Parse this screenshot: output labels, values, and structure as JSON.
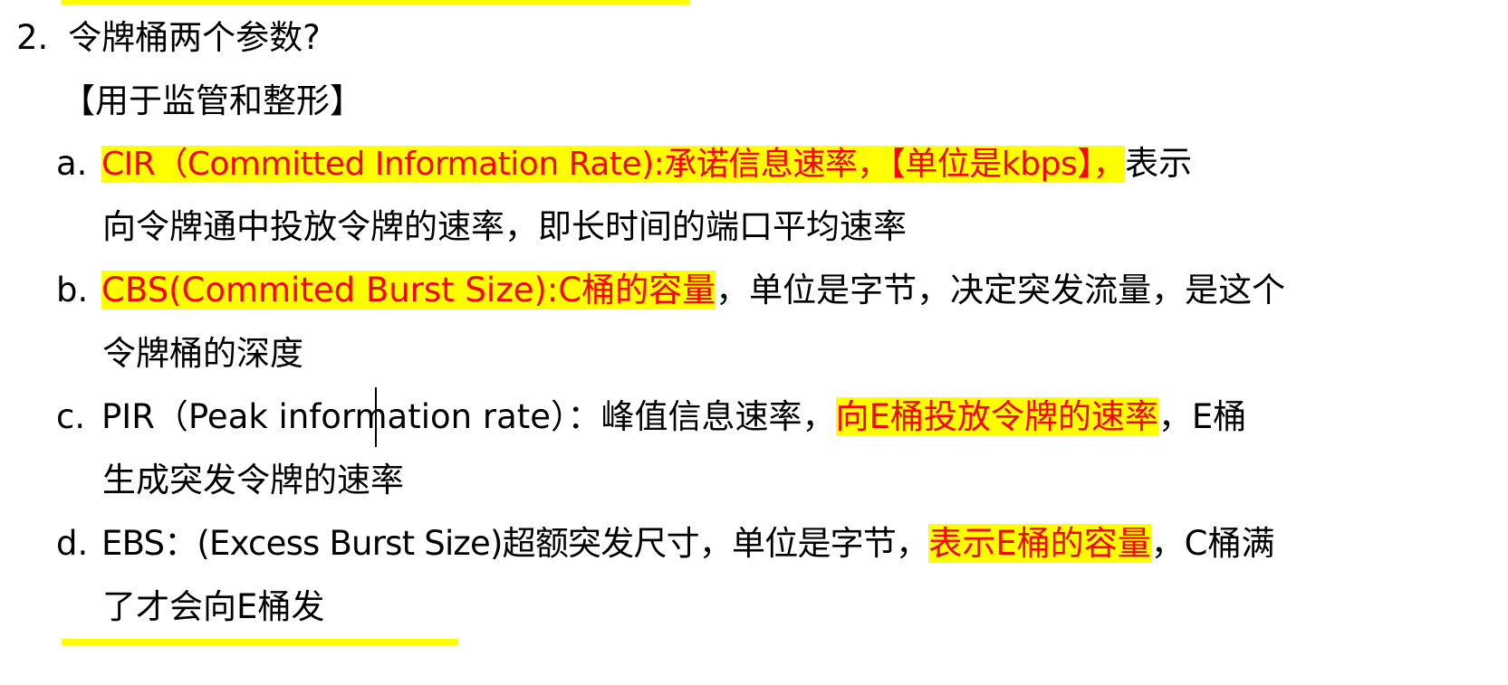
{
  "colors": {
    "highlight": "#ffff00",
    "emphasis_text": "#ff0000",
    "text": "#000000"
  },
  "heading": {
    "number": "2.",
    "text": "令牌桶两个参数?"
  },
  "subheading": "【用于监管和整形】",
  "items": [
    {
      "marker": "a.",
      "highlighted_red": "CIR（Committed Information Rate):承诺信息速率，【单位是kbps】，",
      "rest": "表示",
      "continuation": "向令牌通中投放令牌的速率，即长时间的端口平均速率"
    },
    {
      "marker": "b.",
      "highlighted_red": "CBS(Commited Burst Size):C桶的容量",
      "rest": "，单位是字节，决定突发流量，是这个",
      "continuation": "令牌桶的深度"
    },
    {
      "marker": "c.",
      "text_before": "PIR（Peak information rate）：峰值信息速率，",
      "highlighted_red": "向E桶投放令牌的速率",
      "rest": "，E桶",
      "continuation": "生成突发令牌的速率"
    },
    {
      "marker": "d.",
      "text_before": "EBS：(Excess Burst Size)超额突发尺寸，单位是字节，",
      "highlighted_red": "表示E桶的容量",
      "rest": "，C桶满",
      "continuation": "了才会向E桶发"
    }
  ]
}
